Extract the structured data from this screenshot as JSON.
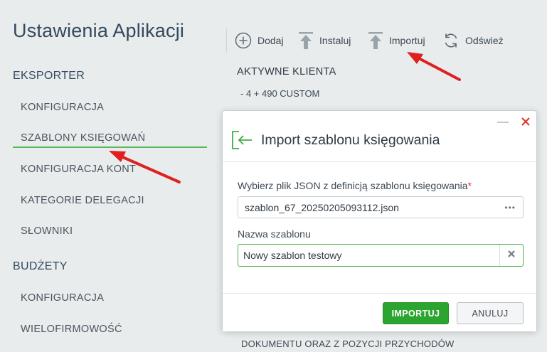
{
  "app": {
    "title": "Ustawienia Aplikacji"
  },
  "sidebar": {
    "sections": [
      {
        "label": "EKSPORTER",
        "items": [
          {
            "label": "KONFIGURACJA"
          },
          {
            "label": "SZABLONY KSIĘGOWAŃ",
            "active": true
          },
          {
            "label": "KONFIGURACJA KONT"
          },
          {
            "label": "KATEGORIE DELEGACJI"
          },
          {
            "label": "SŁOWNIKI"
          }
        ]
      },
      {
        "label": "BUDŻETY",
        "items": [
          {
            "label": "KONFIGURACJA"
          },
          {
            "label": "WIELOFIRMOWOŚĆ"
          }
        ]
      }
    ]
  },
  "toolbar": {
    "buttons": [
      {
        "label": "Dodaj",
        "icon": "plus-circle-icon"
      },
      {
        "label": "Instaluj",
        "icon": "upload-icon"
      },
      {
        "label": "Importuj",
        "icon": "upload-icon"
      },
      {
        "label": "Odśwież",
        "icon": "refresh-icon"
      }
    ]
  },
  "main": {
    "section_title": "AKTYWNE KLIENTA",
    "items": [
      "-  4 + 490 CUSTOM"
    ],
    "bottom_text": "DOKUMENTU ORAZ Z POZYCJI PRZYCHODÓW"
  },
  "modal": {
    "title": "Import szablonu księgowania",
    "icon": "import-enter-icon",
    "file_label": "Wybierz plik JSON z definicją szablonu księgowania",
    "required_mark": "*",
    "file_value": "szablon_67_20250205093112.json",
    "file_dots": "•••",
    "name_label": "Nazwa szablonu",
    "name_value": "Nowy szablon testowy",
    "minimize_symbol": "—",
    "import_button": "IMPORTUJ",
    "cancel_button": "ANULUJ"
  },
  "colors": {
    "accent_green": "#2ba52f",
    "active_underline": "#5cb85c",
    "annotation_arrow": "#e02020",
    "close_red": "#e0352b"
  }
}
